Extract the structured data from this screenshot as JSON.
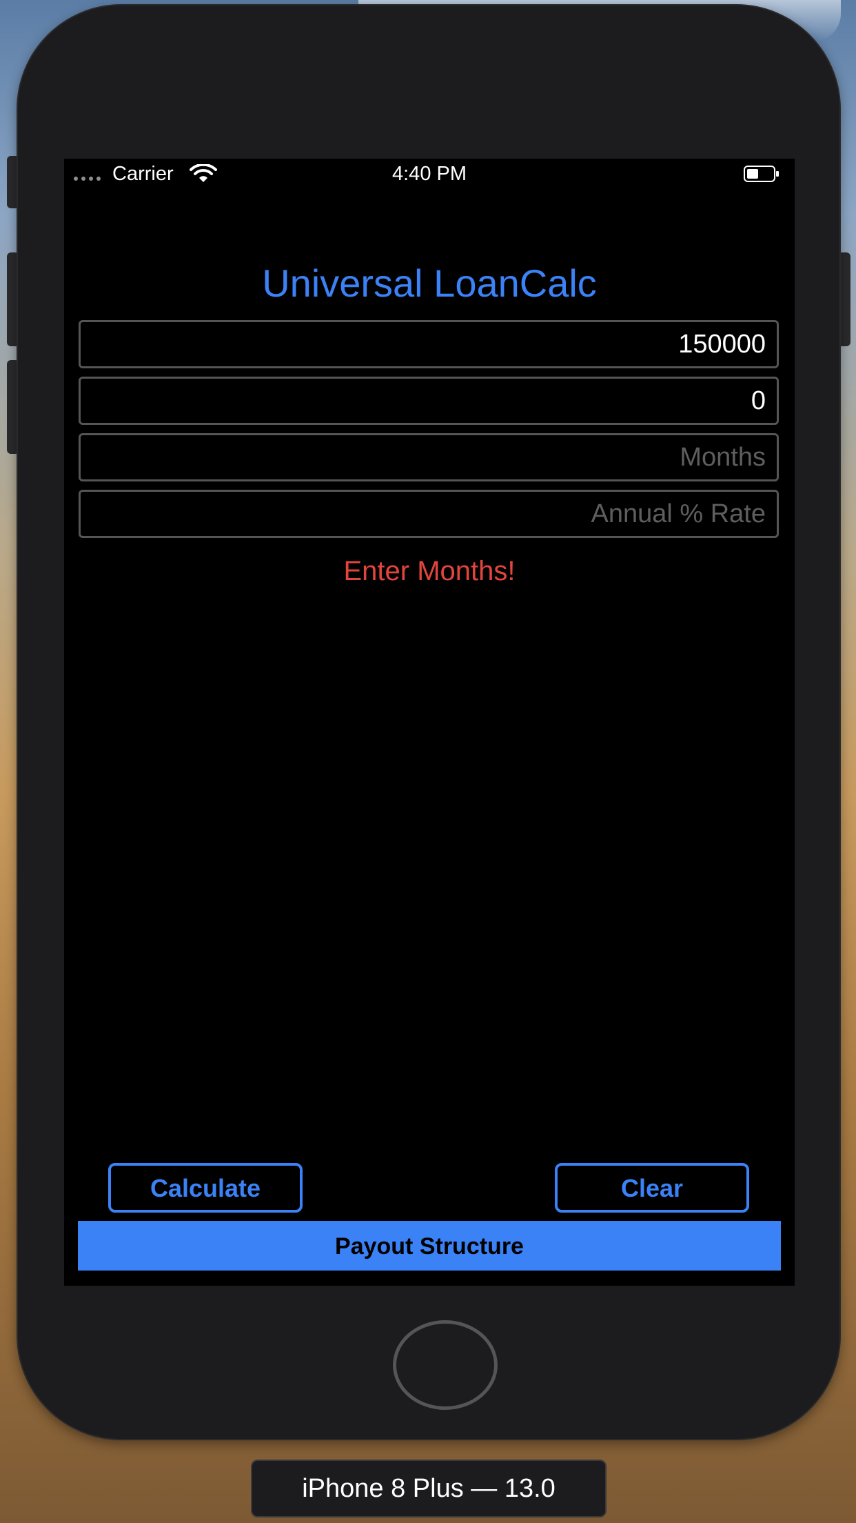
{
  "status_bar": {
    "carrier": "Carrier",
    "time": "4:40 PM",
    "icons": [
      "signal-dots-icon",
      "wifi-icon",
      "battery-icon"
    ]
  },
  "app": {
    "title": "Universal LoanCalc",
    "fields": {
      "principal_value": "150000",
      "down_payment_value": "0",
      "months_placeholder": "Months",
      "rate_placeholder": "Annual % Rate"
    },
    "error_message": "Enter Months!",
    "buttons": {
      "calculate": "Calculate",
      "clear": "Clear",
      "payout": "Payout Structure"
    }
  },
  "simulator": {
    "device_label": "iPhone 8 Plus — 13.0"
  },
  "colors": {
    "accent": "#3b82f6",
    "error": "#e2453c",
    "background": "#000000",
    "field_border": "#555555"
  }
}
